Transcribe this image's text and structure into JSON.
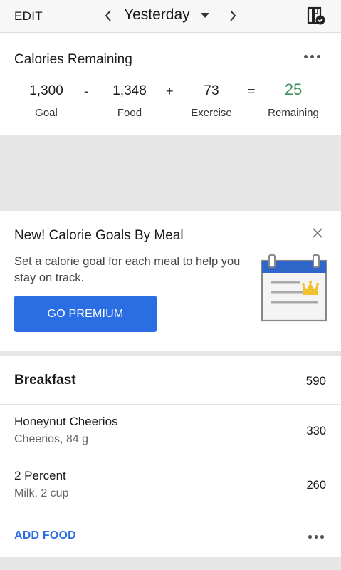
{
  "topbar": {
    "edit_label": "EDIT",
    "date_label": "Yesterday",
    "prev_icon": "chevron-left-icon",
    "next_icon": "chevron-right-icon",
    "dropdown_icon": "caret-down-icon",
    "diary_icon": "diary-complete-icon"
  },
  "calories": {
    "title": "Calories Remaining",
    "goal_value": "1,300",
    "goal_label": "Goal",
    "minus": "-",
    "food_value": "1,348",
    "food_label": "Food",
    "plus": "+",
    "exercise_value": "73",
    "exercise_label": "Exercise",
    "equals": "=",
    "remaining_value": "25",
    "remaining_label": "Remaining",
    "remaining_color": "#3b8f5d"
  },
  "promo": {
    "title": "New! Calorie Goals By Meal",
    "text": "Set a calorie goal for each meal to help you stay on track.",
    "button_label": "GO PREMIUM",
    "button_color": "#2b6ee4",
    "close_icon": "close-icon",
    "illustration_icon": "calendar-crown-icon"
  },
  "meal": {
    "name": "Breakfast",
    "total": "590",
    "items": [
      {
        "name": "Honeynut Cheerios",
        "desc": "Cheerios, 84 g",
        "calories": "330"
      },
      {
        "name": "2 Percent",
        "desc": "Milk, 2 cup",
        "calories": "260"
      }
    ],
    "add_food_label": "ADD FOOD",
    "accent_color": "#2b6ee4"
  }
}
